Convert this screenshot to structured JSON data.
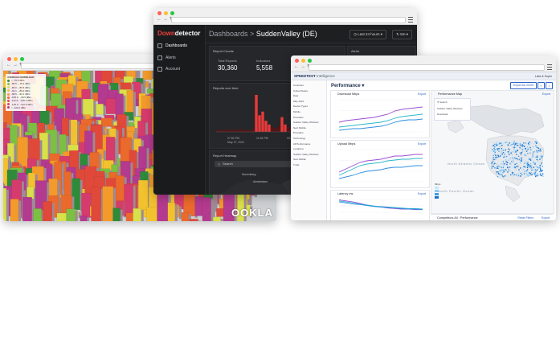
{
  "map_window": {
    "legend": {
      "title": "AVERAGE DOWNLOAD",
      "items": [
        {
          "label": "< -75.2 dBm",
          "color": "#2e8b3a"
        },
        {
          "label": "-80.5 - -75.2 dBm",
          "color": "#7cc043"
        },
        {
          "label": "-86.0 - -80.5 dBm",
          "color": "#d8e04a"
        },
        {
          "label": "-92.1 - -86.0 dBm",
          "color": "#f2c12e"
        },
        {
          "label": "-98.5 - -92.1 dBm",
          "color": "#f39a2b"
        },
        {
          "label": "-105.0 - -98.5 dBm",
          "color": "#ea6a2c"
        },
        {
          "label": "-112.6 - -105.0 dBm",
          "color": "#e0493a"
        },
        {
          "label": "-120.2 - -112.6 dBm",
          "color": "#d63b6d"
        },
        {
          "label": "< -120.2 dBm",
          "color": "#b33a8f"
        }
      ]
    },
    "watermark": "OOKLA"
  },
  "downdetector": {
    "logo_a": "Down",
    "logo_b": "detector",
    "nav": [
      {
        "label": "Dashboards",
        "icon": "grid-icon"
      },
      {
        "label": "Alerts",
        "icon": "bell-icon"
      },
      {
        "label": "Account",
        "icon": "user-icon"
      }
    ],
    "crumb": "Dashboards",
    "separator": ">",
    "title": "SuddenValley (DE)",
    "range_button": "Last 24 hours",
    "refresh_button": "5m",
    "report_counts_label": "Report Counts",
    "alerts_label": "Alerts",
    "total_reports_label": "Total Reports",
    "total_reports_value": "30,360",
    "indicators_label": "Indicators",
    "indicators_value": "5,558",
    "reports_over_time_label": "Reports over time",
    "time_labels": [
      "07:52 PM",
      "11:52 PM",
      "03:52 AM"
    ],
    "time_date": "May 27, 2021",
    "heatmap_label": "Report Heatmap",
    "search_placeholder": "Search",
    "heatmap_places": [
      "Nuremberg",
      "Amsterdam"
    ],
    "bar_values": [
      2,
      2,
      2,
      2,
      3,
      2,
      2,
      3,
      2,
      2,
      2,
      3,
      40,
      18,
      22,
      12,
      8,
      5,
      4,
      6,
      16,
      8,
      5,
      4,
      3,
      3,
      3,
      4,
      5,
      6,
      9,
      6,
      8,
      12,
      10,
      14,
      18,
      22,
      16,
      25
    ],
    "bar_colors": {
      "low": "#5a1414",
      "mid": "#e83a3a",
      "high": "#f0d020"
    }
  },
  "speedtest": {
    "brand": "SPEEDTEST",
    "brand_sub": "Intelligence",
    "user": "Labs & Super",
    "filters": [
      "Countries",
      "United States",
      "Date",
      "May 2021",
      "Device Types",
      "Mobile",
      "Providers",
      "Sudden Valley Wireless",
      "Next Mobile",
      "Providers",
      "Technology",
      "All Performance",
      "Locations",
      "Sudden Valley Wireless",
      "Next Mobile",
      "T-Net"
    ],
    "section_title": "Performance",
    "export_all": "Export As JSON",
    "pill_prev": "<",
    "pill_next": ">",
    "charts": [
      {
        "title": "Download Mbps",
        "export": "Export"
      },
      {
        "title": "Upload Mbps",
        "export": "Export"
      },
      {
        "title": "Latency ms",
        "export": "Export"
      }
    ],
    "x_ticks": [
      "Mar 20",
      "Apr 20",
      "May 20",
      "Jun 20",
      "Jul 20",
      "Aug 20",
      "Sep 20",
      "Oct 20",
      "Nov 20",
      "Dec 20",
      "Jan 21",
      "Feb 21",
      "Mar 21"
    ],
    "map_title": "Performance Map",
    "map_export": "Export",
    "map_search": "Search",
    "map_provider": "Sudden Valley Wireless",
    "map_metric": "Download",
    "oceans": [
      "North Atlantic Ocean",
      "North Pacific Ocean"
    ],
    "map_legend_title": "Mbps",
    "competitors_title": "Competitors All - Performance",
    "reset_filters": "Reset Filters",
    "export": "Export",
    "series_colors": [
      "#9b4fd6",
      "#2bb6c9",
      "#2f8fe0"
    ]
  }
}
